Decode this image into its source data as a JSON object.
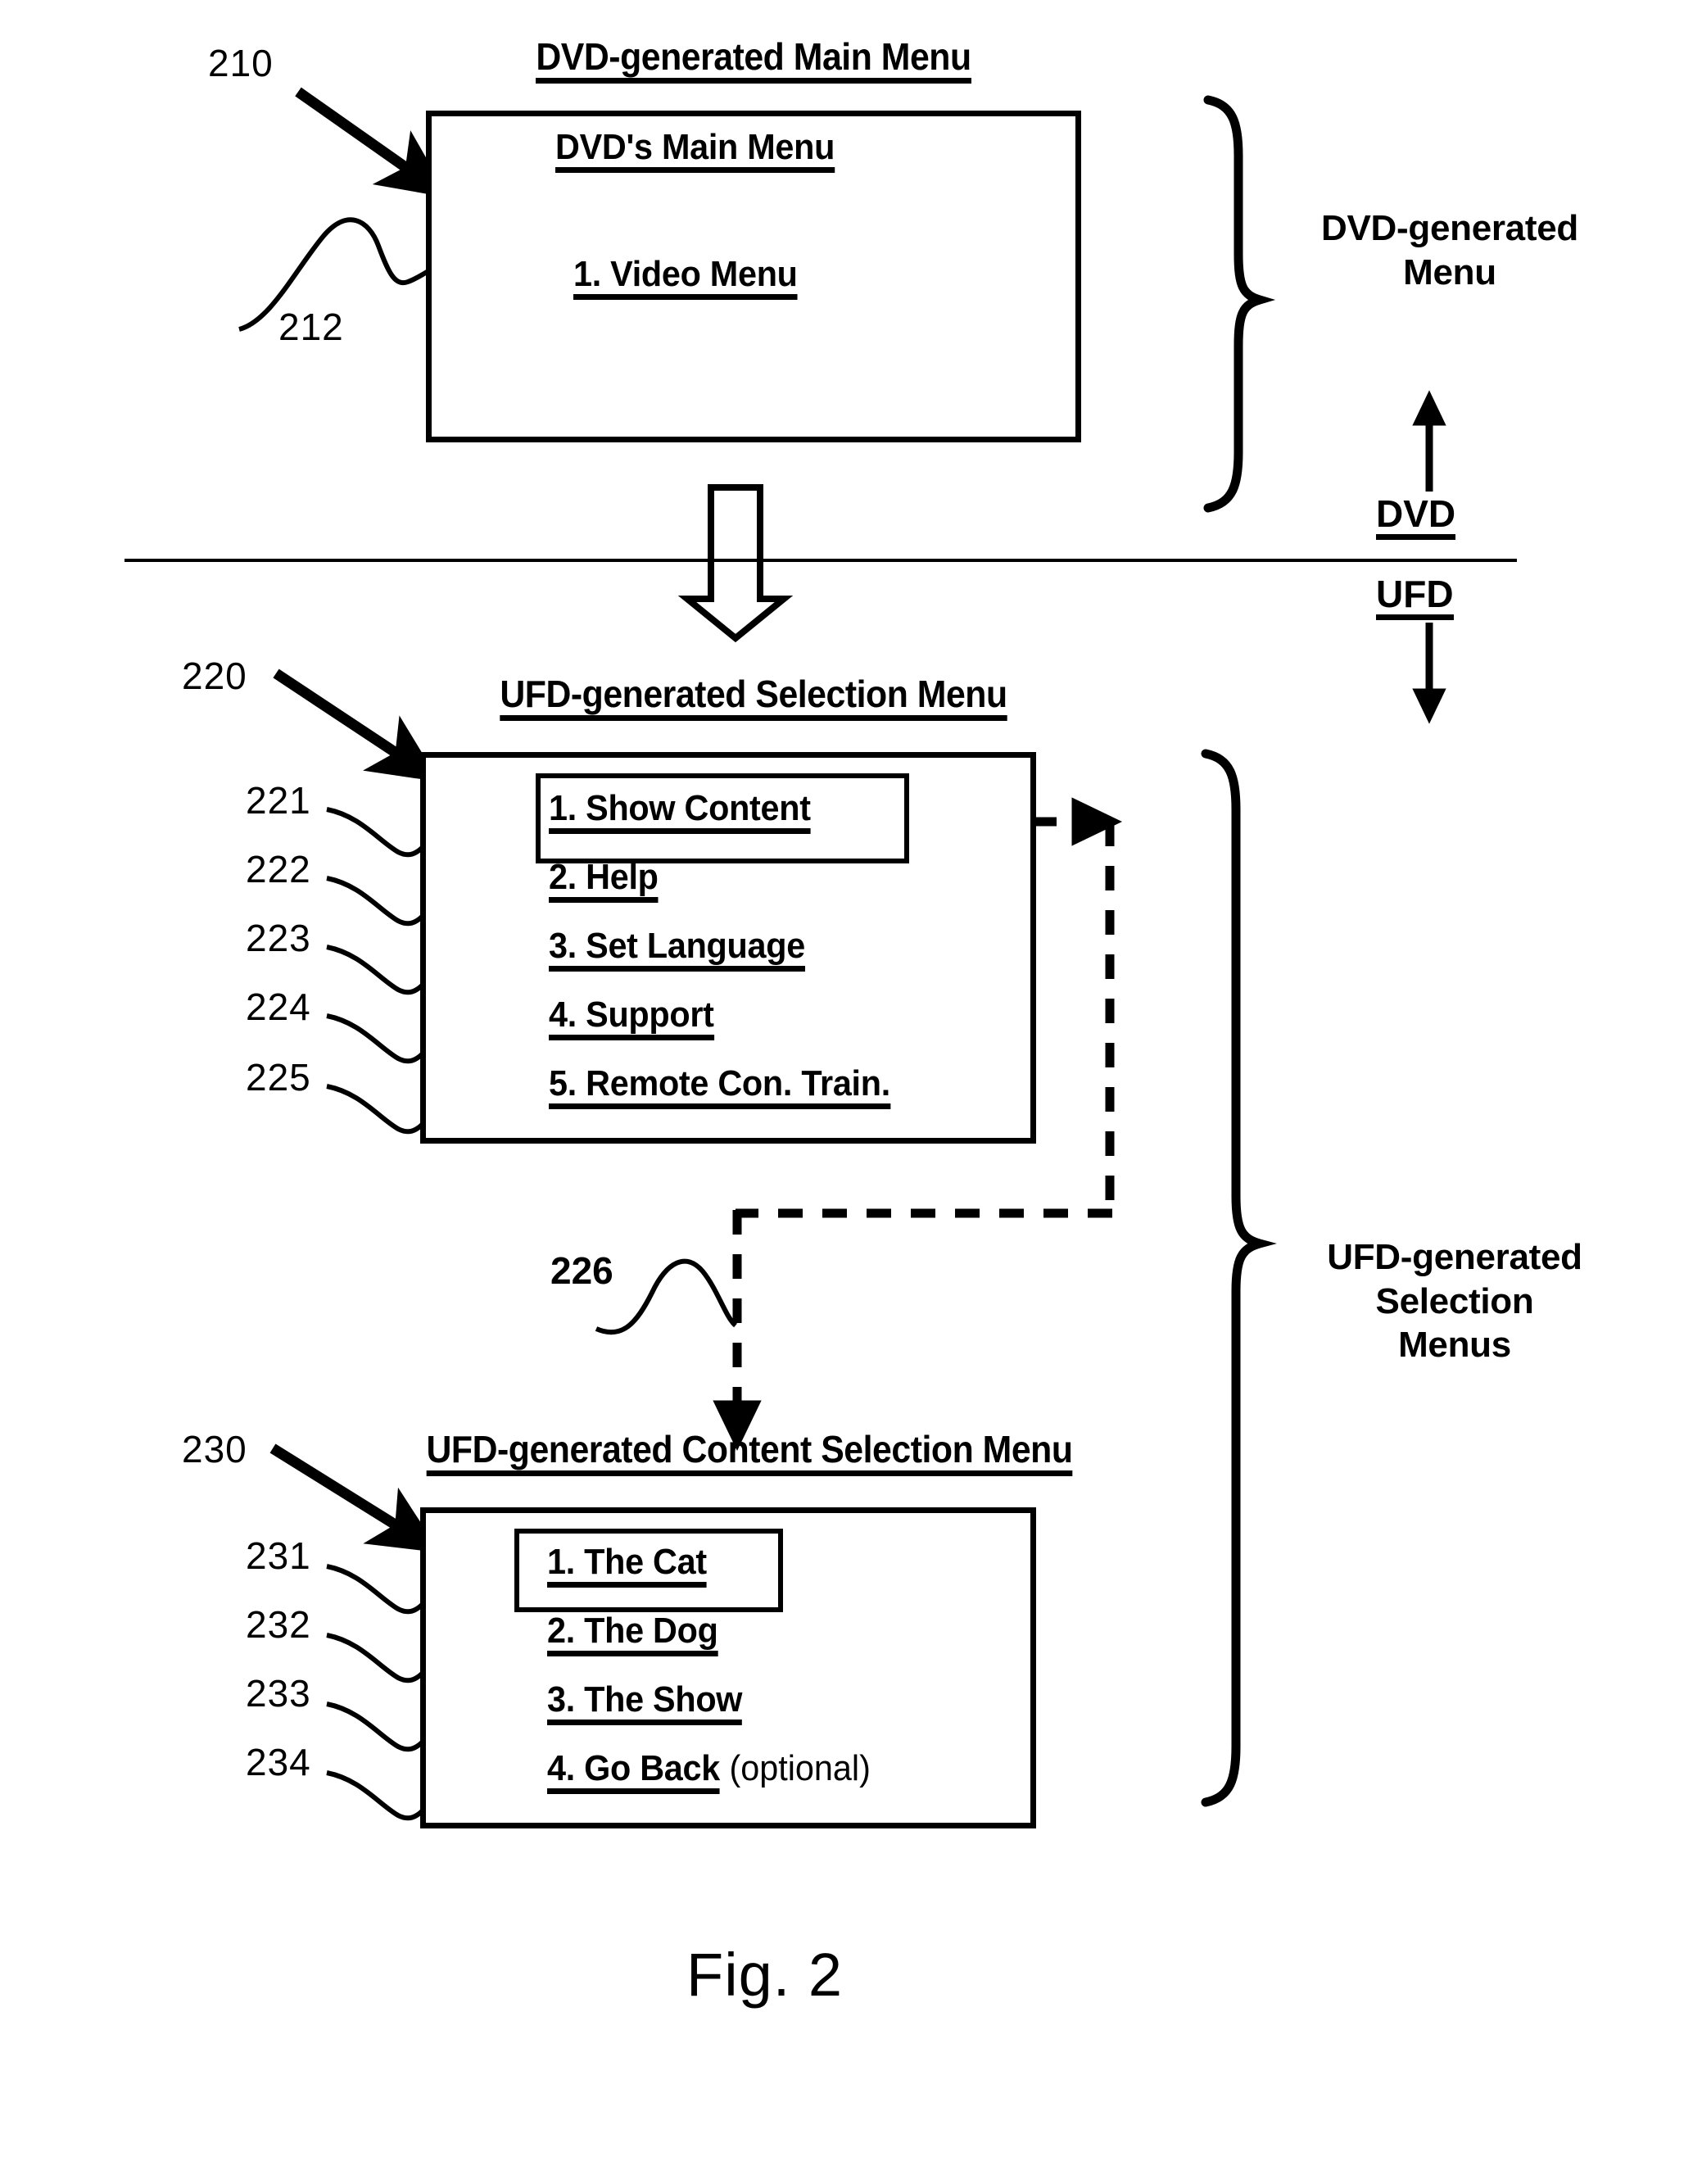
{
  "figure": {
    "caption": "Fig. 2"
  },
  "sections": {
    "dvd": {
      "title": "DVD-generated Main Menu",
      "ref": "210",
      "box": {
        "heading": "DVD's Main Menu",
        "items": [
          {
            "ref": "212",
            "label": "1. Video Menu",
            "selected": false
          }
        ]
      },
      "brace_label": "DVD-generated\nMenu"
    },
    "ufd_selection": {
      "title": "UFD-generated Selection Menu",
      "ref": "220",
      "box": {
        "items": [
          {
            "ref": "221",
            "label": "1. Show Content",
            "selected": true
          },
          {
            "ref": "222",
            "label": "2. Help",
            "selected": false
          },
          {
            "ref": "223",
            "label": "3. Set Language",
            "selected": false
          },
          {
            "ref": "224",
            "label": "4. Support",
            "selected": false
          },
          {
            "ref": "225",
            "label": "5. Remote Con. Train.",
            "selected": false
          }
        ]
      },
      "flow_ref": "226",
      "brace_label": "UFD-generated\nSelection\nMenus"
    },
    "ufd_content": {
      "title": "UFD-generated Content Selection Menu",
      "ref": "230",
      "box": {
        "items": [
          {
            "ref": "231",
            "label": "1. The Cat",
            "selected": true
          },
          {
            "ref": "232",
            "label": "2. The Dog",
            "selected": false
          },
          {
            "ref": "233",
            "label": "3. The Show",
            "selected": false
          },
          {
            "ref": "234",
            "label": "4. Go Back",
            "suffix": " (optional)",
            "selected": false
          }
        ]
      }
    }
  },
  "divider": {
    "above_label": "DVD",
    "below_label": "UFD"
  },
  "colors": {
    "ink": "#000000",
    "paper": "#ffffff"
  }
}
